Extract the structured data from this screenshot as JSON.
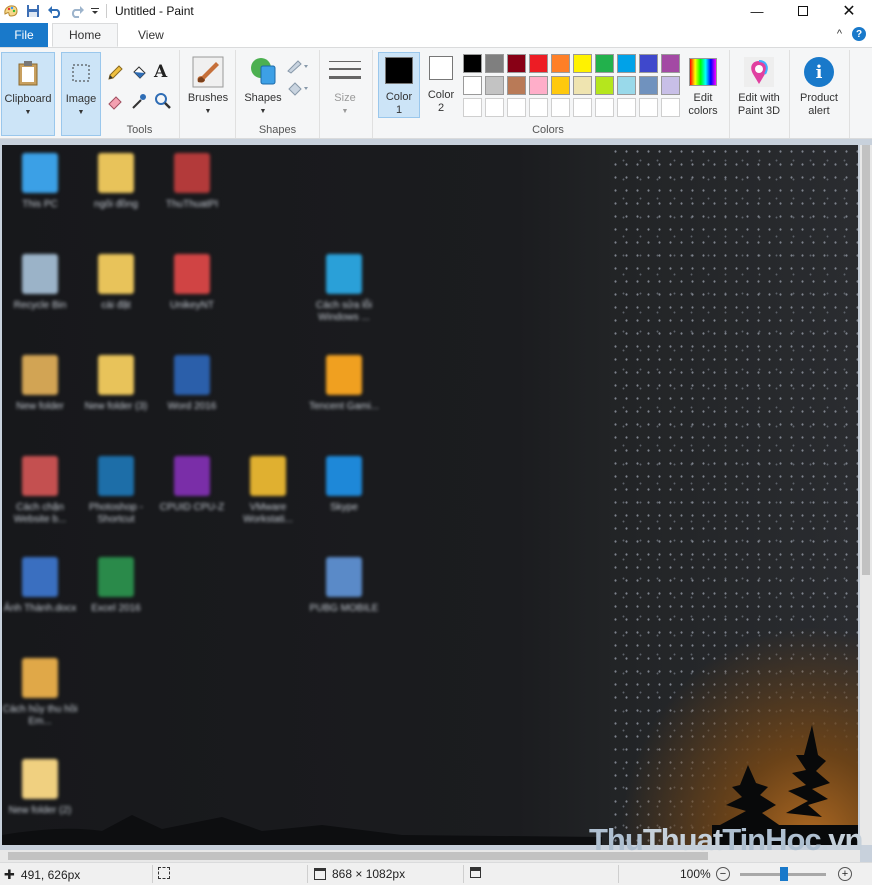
{
  "window": {
    "title": "Untitled - Paint",
    "minimize_icon": "minimize-icon",
    "maximize_icon": "maximize-icon",
    "close_icon": "close-icon"
  },
  "tabs": [
    "File",
    "Home",
    "View"
  ],
  "help": {
    "collapse": "^",
    "help": "?"
  },
  "ribbon": {
    "clipboard": {
      "label": "Clipboard"
    },
    "image": {
      "label": "Image"
    },
    "tools_label": "Tools",
    "brushes": {
      "label": "Brushes"
    },
    "shapes": {
      "label": "Shapes",
      "group_label": "Shapes"
    },
    "size": {
      "label": "Size"
    },
    "color1": {
      "label1": "Color",
      "label2": "1",
      "color": "#000000"
    },
    "color2": {
      "label1": "Color",
      "label2": "2",
      "color": "#ffffff"
    },
    "colors_label": "Colors",
    "edit_colors": {
      "label1": "Edit",
      "label2": "colors"
    },
    "paint3d": {
      "label1": "Edit with",
      "label2": "Paint 3D"
    },
    "product_alert": {
      "label1": "Product",
      "label2": "alert"
    },
    "palette_row1": [
      "#000000",
      "#7f7f7f",
      "#880015",
      "#ed1c24",
      "#ff7f27",
      "#fff200",
      "#22b14c",
      "#00a2e8",
      "#3f48cc",
      "#a349a4"
    ],
    "palette_row2": [
      "#ffffff",
      "#c3c3c3",
      "#b97a57",
      "#ffaec9",
      "#ffc90e",
      "#efe4b0",
      "#b5e61d",
      "#99d9ea",
      "#7092be",
      "#c8bfe7"
    ],
    "palette_row3": [
      "#ffffff",
      "#ffffff",
      "#ffffff",
      "#ffffff",
      "#ffffff",
      "#ffffff",
      "#ffffff",
      "#ffffff",
      "#ffffff",
      "#ffffff"
    ]
  },
  "desktop_icons": [
    {
      "label": "This PC",
      "color": "#3ba0e6"
    },
    {
      "label": "ngôi đồng",
      "color": "#e8c35a"
    },
    {
      "label": "ThuThuatPI",
      "color": "#b33a3a"
    },
    {
      "label": "Recycle Bin",
      "color": "#9bb3c8"
    },
    {
      "label": "cài đặt",
      "color": "#e8c35a"
    },
    {
      "label": "UnikeyNT",
      "color": "#d04444"
    },
    {
      "label": "Cách sửa lỗi Windows ...",
      "color": "#2aa0d8"
    },
    {
      "label": "New folder",
      "color": "#d2a454"
    },
    {
      "label": "New folder (3)",
      "color": "#e8c35a"
    },
    {
      "label": "Word 2016",
      "color": "#2b5faa"
    },
    {
      "label": "Tencent Gami...",
      "color": "#f0a020"
    },
    {
      "label": "Cách chặn Website b...",
      "color": "#c45050"
    },
    {
      "label": "Photoshop - Shortcut",
      "color": "#1d6ea8"
    },
    {
      "label": "CPUID CPU-Z",
      "color": "#7a2ea8"
    },
    {
      "label": "VMware Workstati...",
      "color": "#e0b030"
    },
    {
      "label": "Skype",
      "color": "#1e88d8"
    },
    {
      "label": "Ảnh Thành.docx",
      "color": "#3a6fc0"
    },
    {
      "label": "Excel 2016",
      "color": "#2a8a4a"
    },
    {
      "label": "PUBG MOBILE",
      "color": "#5a8ac8"
    },
    {
      "label": "Cách hủy thu hồi Em...",
      "color": "#e0a848"
    },
    {
      "label": "New folder (2)",
      "color": "#f0d080"
    }
  ],
  "watermark": {
    "a": "Thu",
    "b": "Thuat",
    "c": "TinHoc",
    "d": ".vn"
  },
  "status": {
    "cursor_pos": "491, 626px",
    "image_size": "868 × 1082px",
    "zoom": "100%"
  }
}
